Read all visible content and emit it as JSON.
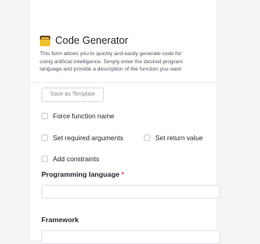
{
  "header": {
    "title": "Code Generator",
    "icon": "construction-icon",
    "description_lines": [
      "This form allows you to quickly and easily generate code for",
      "using artificial intelligence. Simply enter the desired program",
      "language and provide a description of the function you want"
    ]
  },
  "toolbar": {
    "save_template_label": "Save as Template"
  },
  "options": {
    "force_function_name": "Force function name",
    "set_required_arguments": "Set required arguments",
    "set_return_value": "Set return value",
    "add_constraints": "Add constraints"
  },
  "fields": {
    "programming_language_label": "Programming language",
    "required_marker": "*",
    "framework_label": "Framework"
  },
  "colors": {
    "required": "#e5484d",
    "background": "#f4f5f7",
    "panel": "#ffffff"
  }
}
